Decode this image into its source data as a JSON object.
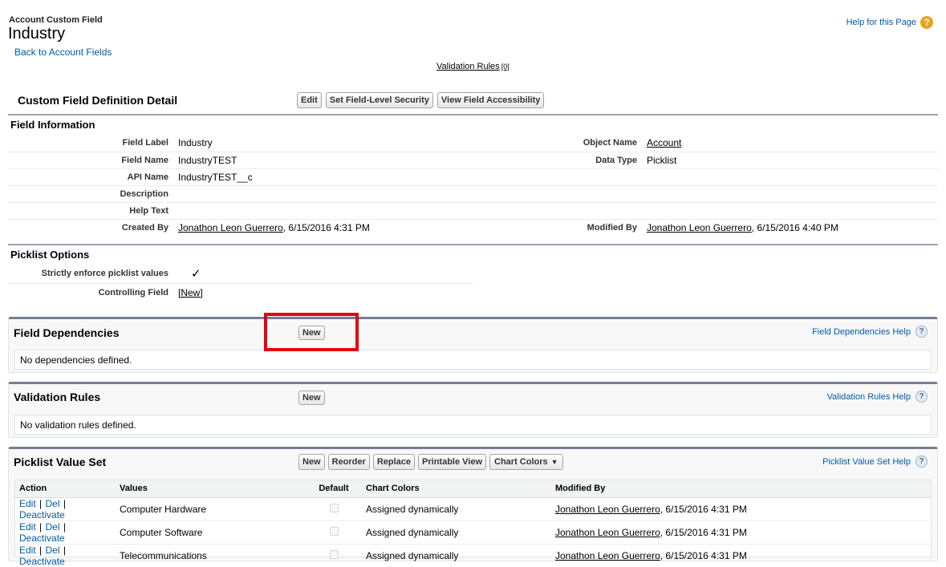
{
  "header": {
    "subtitle": "Account Custom Field",
    "title": "Industry",
    "back_link": "Back to Account Fields",
    "help_link": "Help for this Page",
    "validation_rules_link": "Validation Rules",
    "validation_rules_count": "[0]"
  },
  "detail": {
    "title": "Custom Field Definition Detail",
    "buttons": {
      "edit": "Edit",
      "fls": "Set Field-Level Security",
      "accessibility": "View Field Accessibility"
    }
  },
  "field_info": {
    "heading": "Field Information",
    "field_label_label": "Field Label",
    "field_label_value": "Industry",
    "object_name_label": "Object Name",
    "object_name_value": "Account",
    "field_name_label": "Field Name",
    "field_name_value": "IndustryTEST",
    "data_type_label": "Data Type",
    "data_type_value": "Picklist",
    "api_name_label": "API Name",
    "api_name_value": "IndustryTEST__c",
    "description_label": "Description",
    "help_text_label": "Help Text",
    "created_by_label": "Created By",
    "created_by_user": "Jonathon Leon Guerrero",
    "created_by_date": ", 6/15/2016 4:31 PM",
    "modified_by_label": "Modified By",
    "modified_by_user": "Jonathon Leon Guerrero",
    "modified_by_date": ", 6/15/2016 4:40 PM"
  },
  "picklist_options": {
    "heading": "Picklist Options",
    "strict_label": "Strictly enforce picklist values",
    "strict_value": "✓",
    "controlling_label": "Controlling Field",
    "controlling_value": "[New]"
  },
  "field_dependencies": {
    "title": "Field Dependencies",
    "new_button": "New",
    "help": "Field Dependencies Help",
    "empty": "No dependencies defined."
  },
  "validation_rules": {
    "title": "Validation Rules",
    "new_button": "New",
    "help": "Validation Rules Help",
    "empty": "No validation rules defined."
  },
  "picklist_value_set": {
    "title": "Picklist Value Set",
    "buttons": {
      "new": "New",
      "reorder": "Reorder",
      "replace": "Replace",
      "printable": "Printable View",
      "chart_colors": "Chart Colors"
    },
    "help": "Picklist Value Set Help",
    "columns": {
      "action": "Action",
      "values": "Values",
      "default": "Default",
      "chart_colors": "Chart Colors",
      "modified_by": "Modified By"
    },
    "actions": {
      "edit": "Edit",
      "del": "Del",
      "deactivate": "Deactivate"
    },
    "rows": [
      {
        "value": "Computer Hardware",
        "chart_color": "Assigned dynamically",
        "user": "Jonathon Leon Guerrero",
        "date": ", 6/15/2016 4:31 PM"
      },
      {
        "value": "Computer Software",
        "chart_color": "Assigned dynamically",
        "user": "Jonathon Leon Guerrero",
        "date": ", 6/15/2016 4:31 PM"
      },
      {
        "value": "Telecommunications",
        "chart_color": "Assigned dynamically",
        "user": "Jonathon Leon Guerrero",
        "date": ", 6/15/2016 4:31 PM"
      }
    ]
  }
}
